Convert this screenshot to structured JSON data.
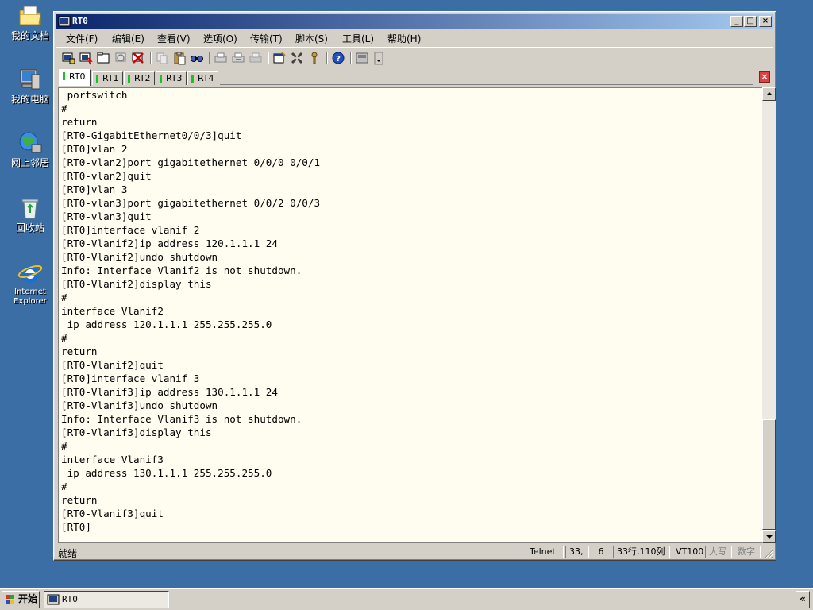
{
  "desktop": {
    "icons": [
      {
        "label": "我的文档"
      },
      {
        "label": "我的电脑"
      },
      {
        "label": "网上邻居"
      },
      {
        "label": "回收站"
      },
      {
        "label": "Internet Explorer"
      }
    ]
  },
  "window": {
    "title": "RT0",
    "menu": [
      "文件(F)",
      "编辑(E)",
      "查看(V)",
      "选项(O)",
      "传输(T)",
      "脚本(S)",
      "工具(L)",
      "帮助(H)"
    ],
    "tabs": [
      "RT0",
      "RT1",
      "RT2",
      "RT3",
      "RT4"
    ],
    "active_tab": "RT0"
  },
  "terminal": {
    "lines": [
      " portswitch",
      "#",
      "return",
      "[RT0-GigabitEthernet0/0/3]quit",
      "[RT0]vlan 2",
      "[RT0-vlan2]port gigabitethernet 0/0/0 0/0/1",
      "[RT0-vlan2]quit",
      "[RT0]vlan 3",
      "[RT0-vlan3]port gigabitethernet 0/0/2 0/0/3",
      "[RT0-vlan3]quit",
      "[RT0]interface vlanif 2",
      "[RT0-Vlanif2]ip address 120.1.1.1 24",
      "[RT0-Vlanif2]undo shutdown",
      "Info: Interface Vlanif2 is not shutdown.",
      "[RT0-Vlanif2]display this",
      "#",
      "interface Vlanif2",
      " ip address 120.1.1.1 255.255.255.0",
      "#",
      "return",
      "[RT0-Vlanif2]quit",
      "[RT0]interface vlanif 3",
      "[RT0-Vlanif3]ip address 130.1.1.1 24",
      "[RT0-Vlanif3]undo shutdown",
      "Info: Interface Vlanif3 is not shutdown.",
      "[RT0-Vlanif3]display this",
      "#",
      "interface Vlanif3",
      " ip address 130.1.1.1 255.255.255.0",
      "#",
      "return",
      "[RT0-Vlanif3]quit",
      "[RT0]"
    ]
  },
  "status": {
    "text": "就绪",
    "protocol": "Telnet",
    "row": "33,",
    "col": "6",
    "size": "33行,110列",
    "terminal_type": "VT100",
    "caps": "大写",
    "num": "数字"
  },
  "taskbar": {
    "start_label": "开始",
    "task_label": "RT0",
    "tray_label": "«"
  }
}
